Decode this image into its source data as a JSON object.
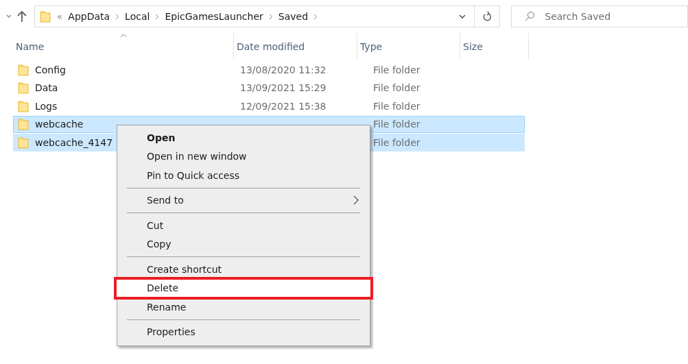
{
  "address_bar": {
    "overflow": "«",
    "path": [
      "AppData",
      "Local",
      "EpicGamesLauncher",
      "Saved"
    ]
  },
  "search": {
    "placeholder": "Search Saved"
  },
  "table": {
    "columns": [
      {
        "label": "Name",
        "sorted": true
      },
      {
        "label": "Date modified",
        "sorted": false
      },
      {
        "label": "Type",
        "sorted": false
      },
      {
        "label": "Size",
        "sorted": false
      }
    ],
    "rows": [
      {
        "name": "Config",
        "date": "13/08/2020 11:32",
        "type": "File folder",
        "selected": false
      },
      {
        "name": "Data",
        "date": "13/09/2021 15:29",
        "type": "File folder",
        "selected": false
      },
      {
        "name": "Logs",
        "date": "12/09/2021 15:38",
        "type": "File folder",
        "selected": false
      },
      {
        "name": "webcache",
        "type": "File folder",
        "selected": true
      },
      {
        "name": "webcache_4147",
        "type": "File folder",
        "selected": true
      }
    ]
  },
  "context_menu": {
    "items": [
      {
        "kind": "item",
        "label": "Open",
        "default": true
      },
      {
        "kind": "item",
        "label": "Open in new window"
      },
      {
        "kind": "item",
        "label": "Pin to Quick access"
      },
      {
        "kind": "separator"
      },
      {
        "kind": "item",
        "label": "Send to",
        "submenu": true
      },
      {
        "kind": "separator"
      },
      {
        "kind": "item",
        "label": "Cut"
      },
      {
        "kind": "item",
        "label": "Copy"
      },
      {
        "kind": "separator"
      },
      {
        "kind": "item",
        "label": "Create shortcut"
      },
      {
        "kind": "item",
        "label": "Delete",
        "highlighted": true
      },
      {
        "kind": "item",
        "label": "Rename"
      },
      {
        "kind": "separator"
      },
      {
        "kind": "item",
        "label": "Properties"
      }
    ]
  }
}
